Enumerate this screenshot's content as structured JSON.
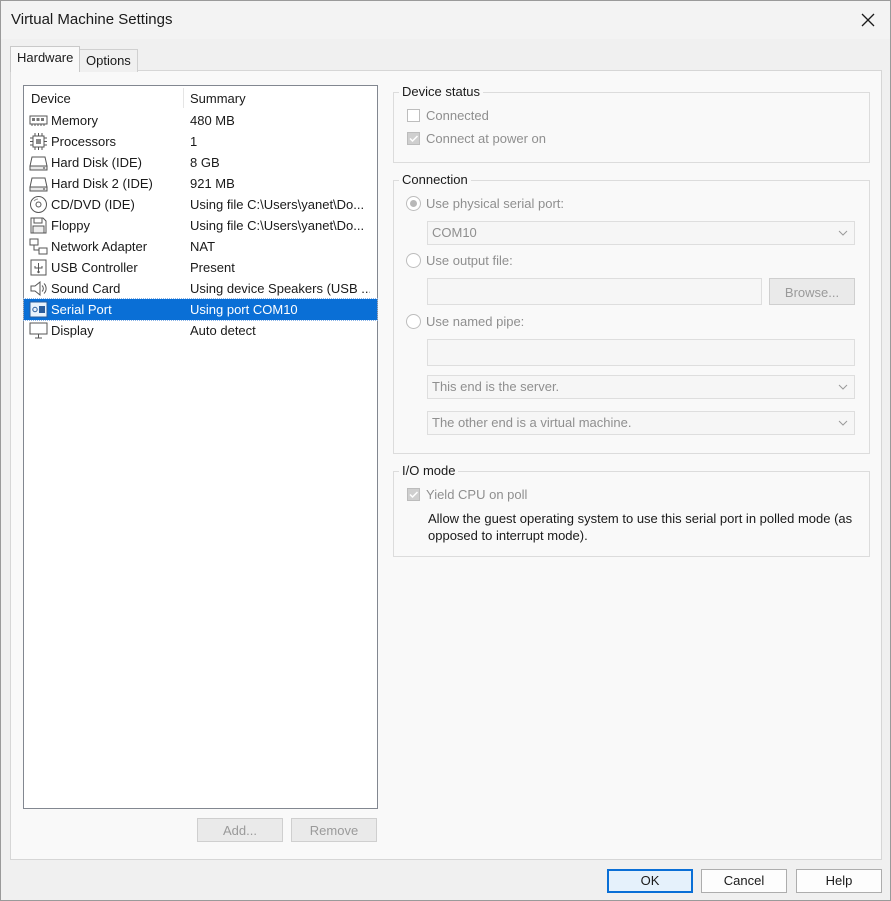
{
  "window": {
    "title": "Virtual Machine Settings"
  },
  "tabs": [
    {
      "label": "Hardware"
    },
    {
      "label": "Options"
    }
  ],
  "device_list": {
    "headers": {
      "device": "Device",
      "summary": "Summary"
    },
    "rows": [
      {
        "device": "Memory",
        "summary": "480 MB",
        "icon": "memory-icon"
      },
      {
        "device": "Processors",
        "summary": "1",
        "icon": "processor-icon"
      },
      {
        "device": "Hard Disk (IDE)",
        "summary": "8 GB",
        "icon": "hard-disk-icon"
      },
      {
        "device": "Hard Disk 2 (IDE)",
        "summary": "921 MB",
        "icon": "hard-disk-icon"
      },
      {
        "device": "CD/DVD (IDE)",
        "summary": "Using file C:\\Users\\yanet\\Do...",
        "icon": "cd-dvd-icon"
      },
      {
        "device": "Floppy",
        "summary": "Using file C:\\Users\\yanet\\Do...",
        "icon": "floppy-icon"
      },
      {
        "device": "Network Adapter",
        "summary": "NAT",
        "icon": "network-adapter-icon"
      },
      {
        "device": "USB Controller",
        "summary": "Present",
        "icon": "usb-icon"
      },
      {
        "device": "Sound Card",
        "summary": "Using device Speakers (USB ...",
        "icon": "speaker-icon"
      },
      {
        "device": "Serial Port",
        "summary": "Using port COM10",
        "icon": "serial-port-icon",
        "selected": true
      },
      {
        "device": "Display",
        "summary": "Auto detect",
        "icon": "display-icon"
      }
    ]
  },
  "list_buttons": {
    "add": "Add...",
    "remove": "Remove"
  },
  "device_status": {
    "label": "Device status",
    "connected": {
      "label": "Connected",
      "checked": false
    },
    "connect_power_on": {
      "label": "Connect at power on",
      "checked": true
    }
  },
  "connection": {
    "label": "Connection",
    "physical": {
      "label": "Use physical serial port:",
      "selected": true,
      "value": "COM10"
    },
    "output_file": {
      "label": "Use output file:",
      "value": "",
      "browse": "Browse..."
    },
    "named_pipe": {
      "label": "Use named pipe:",
      "value": "",
      "end_option": "This end is the server.",
      "other_option": "The other end is a virtual machine."
    }
  },
  "io_mode": {
    "label": "I/O mode",
    "yield": {
      "label": "Yield CPU on poll",
      "checked": true
    },
    "description": "Allow the guest operating system to use this serial port in polled mode (as opposed to interrupt mode)."
  },
  "footer": {
    "ok": "OK",
    "cancel": "Cancel",
    "help": "Help"
  }
}
